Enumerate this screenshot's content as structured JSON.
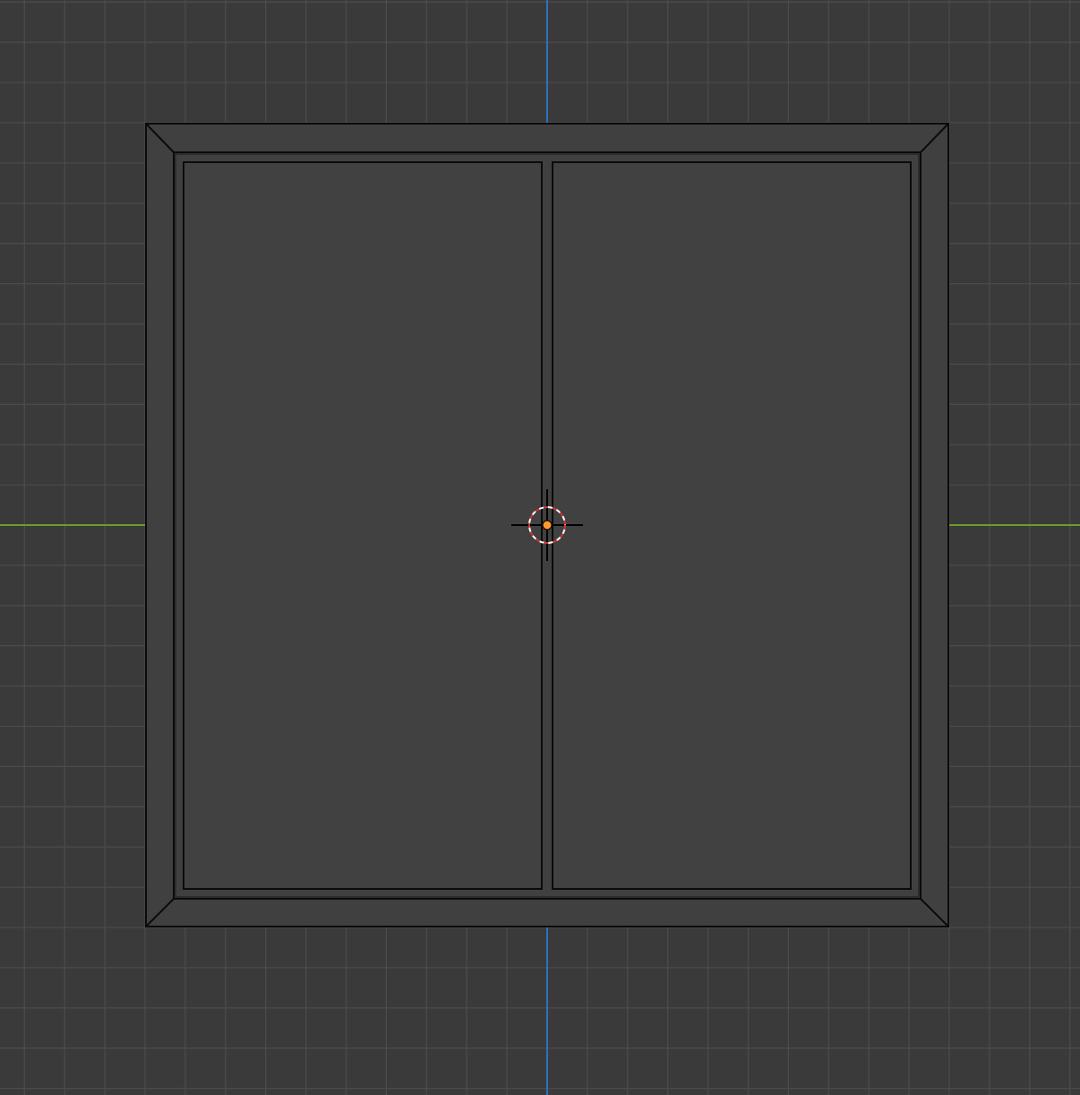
{
  "viewport": {
    "background_color": "#3a3a3a",
    "grid_color": "#4b4b4b",
    "axis_x_color": "#6c9d2a",
    "axis_z_color": "#2f6fc7"
  },
  "object": {
    "face_color": "#404040",
    "edge_color": "#0b0b0b",
    "origin_color": "#ff9a2e"
  },
  "cursor": {
    "icon": "3d-cursor-icon",
    "ring_red": "#d33232",
    "ring_white": "#ffffff",
    "crosshair_color": "#000000"
  }
}
